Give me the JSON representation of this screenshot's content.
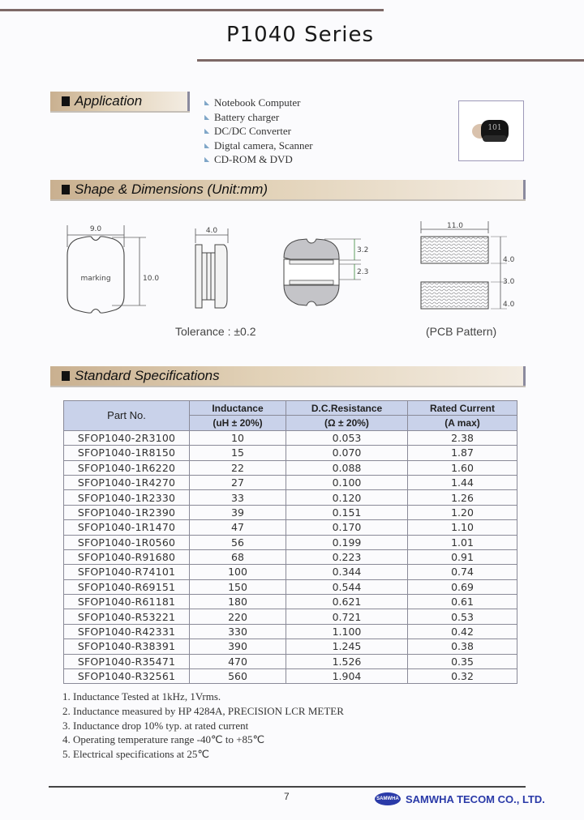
{
  "title": "P1040 Series",
  "sections": {
    "application": "Application",
    "shape": "Shape & Dimensions (Unit:mm)",
    "specs": "Standard Specifications"
  },
  "applications": [
    "Notebook Computer",
    "Battery charger",
    "DC/DC Converter",
    "Digtal camera, Scanner",
    "CD-ROM & DVD"
  ],
  "photo_marking": "101",
  "dimensions": {
    "front_width": "9.0",
    "front_height": "10.0",
    "front_label": "marking",
    "side_width": "4.0",
    "bottom_top": "3.2",
    "bottom_gap": "2.3",
    "pcb_width": "11.0",
    "pcb_pad1": "4.0",
    "pcb_gap": "3.0",
    "pcb_pad2": "4.0",
    "tolerance": "Tolerance : ±0.2",
    "pcb_caption": "(PCB Pattern)"
  },
  "table": {
    "headers": {
      "part": "Part No.",
      "inductance": "Inductance",
      "inductance_unit": "(uH ± 20%)",
      "resistance": "D.C.Resistance",
      "resistance_unit": "(Ω ± 20%)",
      "current": "Rated Current",
      "current_unit": "(A max)"
    },
    "rows": [
      {
        "part": "SFOP1040-2R3100",
        "ind": "10",
        "dcr": "0.053",
        "cur": "2.38"
      },
      {
        "part": "SFOP1040-1R8150",
        "ind": "15",
        "dcr": "0.070",
        "cur": "1.87"
      },
      {
        "part": "SFOP1040-1R6220",
        "ind": "22",
        "dcr": "0.088",
        "cur": "1.60"
      },
      {
        "part": "SFOP1040-1R4270",
        "ind": "27",
        "dcr": "0.100",
        "cur": "1.44"
      },
      {
        "part": "SFOP1040-1R2330",
        "ind": "33",
        "dcr": "0.120",
        "cur": "1.26"
      },
      {
        "part": "SFOP1040-1R2390",
        "ind": "39",
        "dcr": "0.151",
        "cur": "1.20"
      },
      {
        "part": "SFOP1040-1R1470",
        "ind": "47",
        "dcr": "0.170",
        "cur": "1.10"
      },
      {
        "part": "SFOP1040-1R0560",
        "ind": "56",
        "dcr": "0.199",
        "cur": "1.01"
      },
      {
        "part": "SFOP1040-R91680",
        "ind": "68",
        "dcr": "0.223",
        "cur": "0.91"
      },
      {
        "part": "SFOP1040-R74101",
        "ind": "100",
        "dcr": "0.344",
        "cur": "0.74"
      },
      {
        "part": "SFOP1040-R69151",
        "ind": "150",
        "dcr": "0.544",
        "cur": "0.69"
      },
      {
        "part": "SFOP1040-R61181",
        "ind": "180",
        "dcr": "0.621",
        "cur": "0.61"
      },
      {
        "part": "SFOP1040-R53221",
        "ind": "220",
        "dcr": "0.721",
        "cur": "0.53"
      },
      {
        "part": "SFOP1040-R42331",
        "ind": "330",
        "dcr": "1.100",
        "cur": "0.42"
      },
      {
        "part": "SFOP1040-R38391",
        "ind": "390",
        "dcr": "1.245",
        "cur": "0.38"
      },
      {
        "part": "SFOP1040-R35471",
        "ind": "470",
        "dcr": "1.526",
        "cur": "0.35"
      },
      {
        "part": "SFOP1040-R32561",
        "ind": "560",
        "dcr": "1.904",
        "cur": "0.32"
      }
    ]
  },
  "notes": [
    "1. Inductance Tested at 1kHz, 1Vrms.",
    "2. Inductance measured by HP 4284A, PRECISION LCR METER",
    "3. Inductance drop 10% typ. at rated current",
    "4. Operating temperature range -40℃ to +85℃",
    "5. Electrical specifications at 25℃"
  ],
  "footer": {
    "page": "7",
    "logo_text": "SAMWHA",
    "company": "SAMWHA TECOM CO., LTD."
  }
}
